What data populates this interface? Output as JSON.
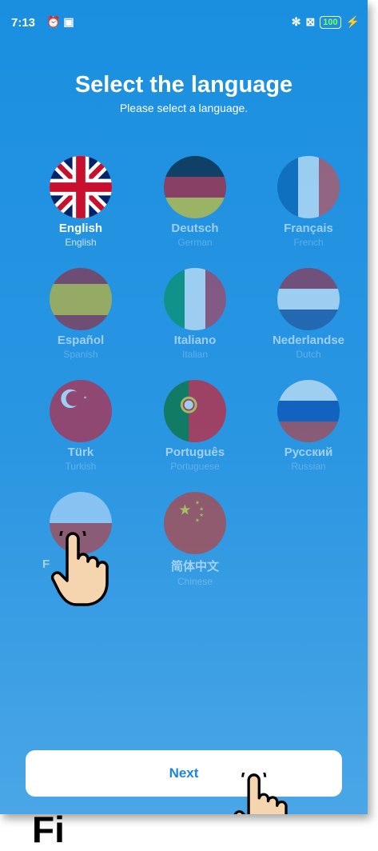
{
  "status_bar": {
    "time": "7:13",
    "icons_left": "⏰ ▣",
    "bluetooth": "✻",
    "signal": "⊠",
    "battery": "100",
    "charging": "⚡"
  },
  "header": {
    "title": "Select the language",
    "subtitle": "Please select a language."
  },
  "languages": [
    {
      "name": "English",
      "sub": "English"
    },
    {
      "name": "Deutsch",
      "sub": "German"
    },
    {
      "name": "Français",
      "sub": "French"
    },
    {
      "name": "Español",
      "sub": "Spanish"
    },
    {
      "name": "Italiano",
      "sub": "Italian"
    },
    {
      "name": "Nederlandse",
      "sub": "Dutch"
    },
    {
      "name": "Türk",
      "sub": "Turkish"
    },
    {
      "name": "Português",
      "sub": "Portuguese"
    },
    {
      "name": "Русский",
      "sub": "Russian"
    },
    {
      "name": "F",
      "sub": ""
    },
    {
      "name": "简体中文",
      "sub": "Chinese"
    }
  ],
  "selected_language": "English",
  "next_button": {
    "label": "Next"
  },
  "footer_text": "Fi",
  "colors": {
    "background": "#1a8fe0",
    "accent_text": "#1b87d8"
  }
}
